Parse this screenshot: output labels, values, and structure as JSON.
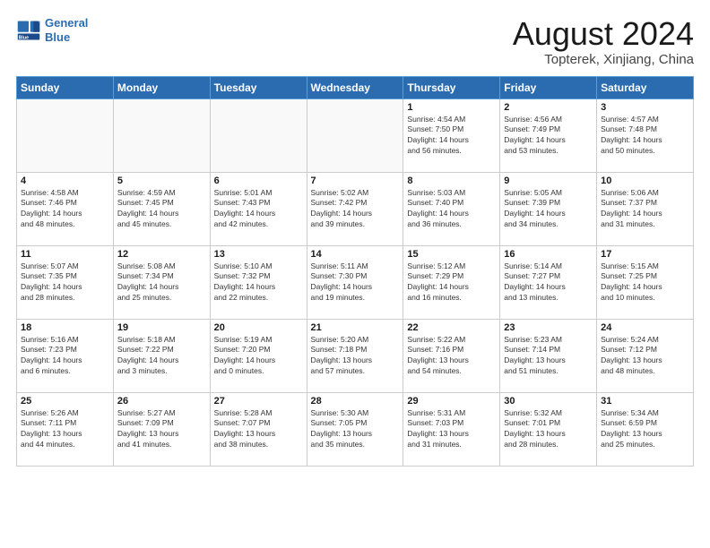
{
  "header": {
    "logo_line1": "General",
    "logo_line2": "Blue",
    "month": "August 2024",
    "location": "Topterek, Xinjiang, China"
  },
  "weekdays": [
    "Sunday",
    "Monday",
    "Tuesday",
    "Wednesday",
    "Thursday",
    "Friday",
    "Saturday"
  ],
  "weeks": [
    [
      {
        "day": "",
        "info": ""
      },
      {
        "day": "",
        "info": ""
      },
      {
        "day": "",
        "info": ""
      },
      {
        "day": "",
        "info": ""
      },
      {
        "day": "1",
        "info": "Sunrise: 4:54 AM\nSunset: 7:50 PM\nDaylight: 14 hours\nand 56 minutes."
      },
      {
        "day": "2",
        "info": "Sunrise: 4:56 AM\nSunset: 7:49 PM\nDaylight: 14 hours\nand 53 minutes."
      },
      {
        "day": "3",
        "info": "Sunrise: 4:57 AM\nSunset: 7:48 PM\nDaylight: 14 hours\nand 50 minutes."
      }
    ],
    [
      {
        "day": "4",
        "info": "Sunrise: 4:58 AM\nSunset: 7:46 PM\nDaylight: 14 hours\nand 48 minutes."
      },
      {
        "day": "5",
        "info": "Sunrise: 4:59 AM\nSunset: 7:45 PM\nDaylight: 14 hours\nand 45 minutes."
      },
      {
        "day": "6",
        "info": "Sunrise: 5:01 AM\nSunset: 7:43 PM\nDaylight: 14 hours\nand 42 minutes."
      },
      {
        "day": "7",
        "info": "Sunrise: 5:02 AM\nSunset: 7:42 PM\nDaylight: 14 hours\nand 39 minutes."
      },
      {
        "day": "8",
        "info": "Sunrise: 5:03 AM\nSunset: 7:40 PM\nDaylight: 14 hours\nand 36 minutes."
      },
      {
        "day": "9",
        "info": "Sunrise: 5:05 AM\nSunset: 7:39 PM\nDaylight: 14 hours\nand 34 minutes."
      },
      {
        "day": "10",
        "info": "Sunrise: 5:06 AM\nSunset: 7:37 PM\nDaylight: 14 hours\nand 31 minutes."
      }
    ],
    [
      {
        "day": "11",
        "info": "Sunrise: 5:07 AM\nSunset: 7:35 PM\nDaylight: 14 hours\nand 28 minutes."
      },
      {
        "day": "12",
        "info": "Sunrise: 5:08 AM\nSunset: 7:34 PM\nDaylight: 14 hours\nand 25 minutes."
      },
      {
        "day": "13",
        "info": "Sunrise: 5:10 AM\nSunset: 7:32 PM\nDaylight: 14 hours\nand 22 minutes."
      },
      {
        "day": "14",
        "info": "Sunrise: 5:11 AM\nSunset: 7:30 PM\nDaylight: 14 hours\nand 19 minutes."
      },
      {
        "day": "15",
        "info": "Sunrise: 5:12 AM\nSunset: 7:29 PM\nDaylight: 14 hours\nand 16 minutes."
      },
      {
        "day": "16",
        "info": "Sunrise: 5:14 AM\nSunset: 7:27 PM\nDaylight: 14 hours\nand 13 minutes."
      },
      {
        "day": "17",
        "info": "Sunrise: 5:15 AM\nSunset: 7:25 PM\nDaylight: 14 hours\nand 10 minutes."
      }
    ],
    [
      {
        "day": "18",
        "info": "Sunrise: 5:16 AM\nSunset: 7:23 PM\nDaylight: 14 hours\nand 6 minutes."
      },
      {
        "day": "19",
        "info": "Sunrise: 5:18 AM\nSunset: 7:22 PM\nDaylight: 14 hours\nand 3 minutes."
      },
      {
        "day": "20",
        "info": "Sunrise: 5:19 AM\nSunset: 7:20 PM\nDaylight: 14 hours\nand 0 minutes."
      },
      {
        "day": "21",
        "info": "Sunrise: 5:20 AM\nSunset: 7:18 PM\nDaylight: 13 hours\nand 57 minutes."
      },
      {
        "day": "22",
        "info": "Sunrise: 5:22 AM\nSunset: 7:16 PM\nDaylight: 13 hours\nand 54 minutes."
      },
      {
        "day": "23",
        "info": "Sunrise: 5:23 AM\nSunset: 7:14 PM\nDaylight: 13 hours\nand 51 minutes."
      },
      {
        "day": "24",
        "info": "Sunrise: 5:24 AM\nSunset: 7:12 PM\nDaylight: 13 hours\nand 48 minutes."
      }
    ],
    [
      {
        "day": "25",
        "info": "Sunrise: 5:26 AM\nSunset: 7:11 PM\nDaylight: 13 hours\nand 44 minutes."
      },
      {
        "day": "26",
        "info": "Sunrise: 5:27 AM\nSunset: 7:09 PM\nDaylight: 13 hours\nand 41 minutes."
      },
      {
        "day": "27",
        "info": "Sunrise: 5:28 AM\nSunset: 7:07 PM\nDaylight: 13 hours\nand 38 minutes."
      },
      {
        "day": "28",
        "info": "Sunrise: 5:30 AM\nSunset: 7:05 PM\nDaylight: 13 hours\nand 35 minutes."
      },
      {
        "day": "29",
        "info": "Sunrise: 5:31 AM\nSunset: 7:03 PM\nDaylight: 13 hours\nand 31 minutes."
      },
      {
        "day": "30",
        "info": "Sunrise: 5:32 AM\nSunset: 7:01 PM\nDaylight: 13 hours\nand 28 minutes."
      },
      {
        "day": "31",
        "info": "Sunrise: 5:34 AM\nSunset: 6:59 PM\nDaylight: 13 hours\nand 25 minutes."
      }
    ]
  ]
}
